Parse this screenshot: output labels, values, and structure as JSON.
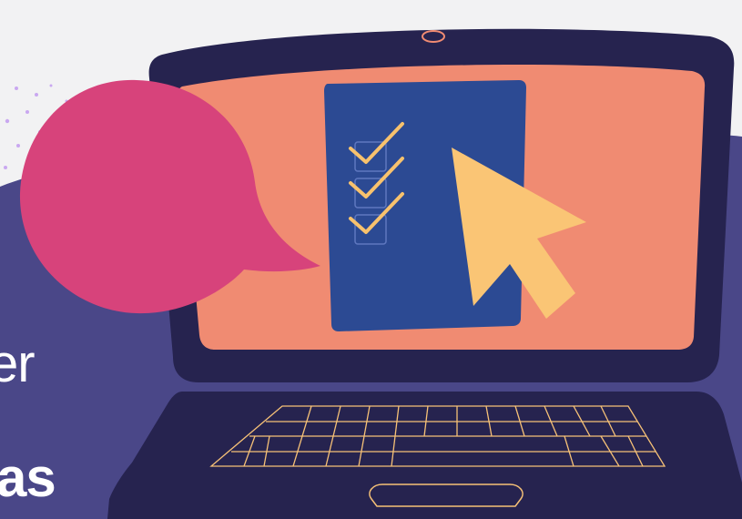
{
  "headline": {
    "line1": "er",
    "line2": "as"
  },
  "colors": {
    "background": "#f2f2f3",
    "blob": "#4a4788",
    "laptop_body": "#26234f",
    "screen": "#f08b72",
    "document": "#2c4a93",
    "checkmark": "#f8c26d",
    "cursor": "#fac575",
    "speech_bubble": "#d7437b",
    "keyboard_lines": "#f6c177",
    "dots": "#c9a8f0"
  },
  "illustration": {
    "checklist_items": 3,
    "checked_items": 3,
    "icons": [
      "speech-bubble-icon",
      "laptop-icon",
      "checklist-document-icon",
      "checkmark-icon",
      "cursor-arrow-icon",
      "keyboard-icon",
      "trackpad-icon",
      "webcam-icon"
    ]
  }
}
